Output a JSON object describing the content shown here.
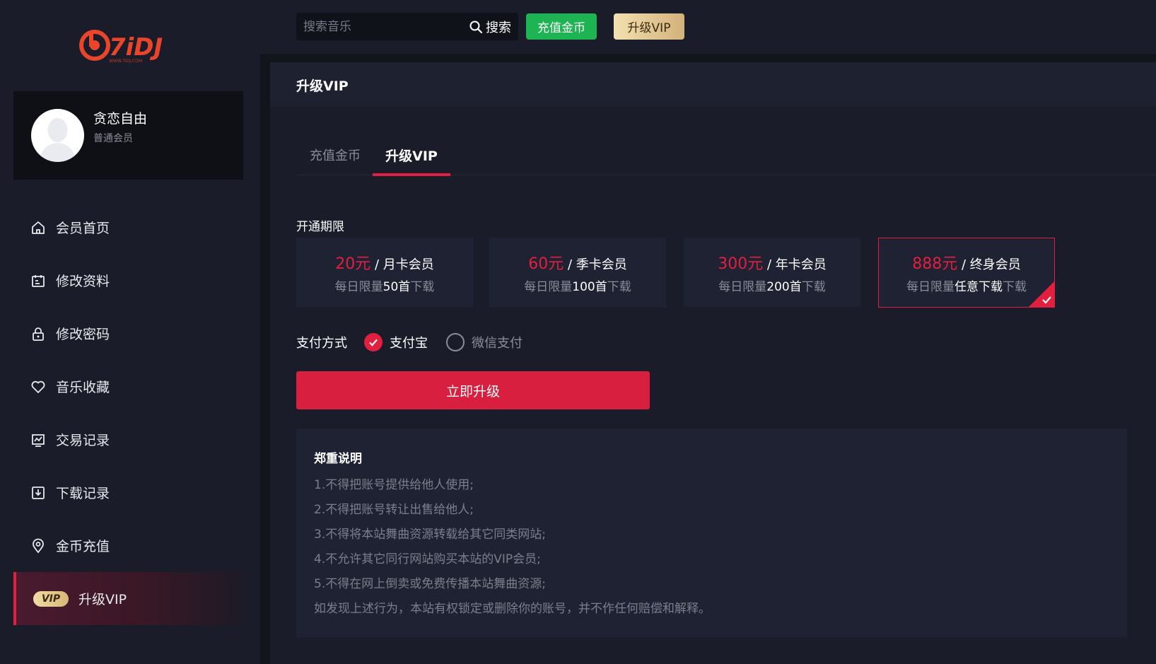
{
  "logo": {
    "text": "7iDJ",
    "sub": "WWW.7IDJ.COM"
  },
  "user": {
    "name": "贪恋自由",
    "level": "普通会员"
  },
  "sidebar": {
    "items": [
      {
        "label": "会员首页",
        "icon": "home-icon"
      },
      {
        "label": "修改资料",
        "icon": "edit-profile-icon"
      },
      {
        "label": "修改密码",
        "icon": "lock-icon"
      },
      {
        "label": "音乐收藏",
        "icon": "heart-icon"
      },
      {
        "label": "交易记录",
        "icon": "chart-icon"
      },
      {
        "label": "下载记录",
        "icon": "download-icon"
      },
      {
        "label": "金币充值",
        "icon": "location-icon"
      },
      {
        "label": "升级VIP",
        "icon": "vip-icon",
        "badge": "VIP",
        "active": true
      }
    ]
  },
  "topbar": {
    "search_placeholder": "搜索音乐",
    "search_label": "搜索",
    "recharge_label": "充值金币",
    "vip_label": "升级VIP"
  },
  "content": {
    "title": "升级VIP",
    "tabs": [
      {
        "label": "充值金币",
        "active": false
      },
      {
        "label": "升级VIP",
        "active": true
      }
    ],
    "period_label": "开通期限",
    "plans": [
      {
        "price": "20元",
        "name": "/ 月卡会员",
        "limit_prefix": "每日限量",
        "limit_value": "50首",
        "limit_suffix": "下载",
        "selected": false
      },
      {
        "price": "60元",
        "name": "/ 季卡会员",
        "limit_prefix": "每日限量",
        "limit_value": "100首",
        "limit_suffix": "下载",
        "selected": false
      },
      {
        "price": "300元",
        "name": "/ 年卡会员",
        "limit_prefix": "每日限量",
        "limit_value": "200首",
        "limit_suffix": "下载",
        "selected": false
      },
      {
        "price": "888元",
        "name": "/ 终身会员",
        "limit_prefix": "每日限量",
        "limit_value": "任意下载",
        "limit_suffix": "下载",
        "selected": true
      }
    ],
    "payment": {
      "label": "支付方式",
      "options": [
        {
          "label": "支付宝",
          "selected": true
        },
        {
          "label": "微信支付",
          "selected": false
        }
      ]
    },
    "submit_label": "立即升级",
    "notice": {
      "title": "郑重说明",
      "lines": [
        "1.不得把账号提供给他人使用;",
        "2.不得把账号转让出售给他人;",
        "3.不得将本站舞曲资源转载给其它同类网站;",
        "4.不允许其它同行网站购买本站的VIP会员;",
        "5.不得在网上倒卖或免费传播本站舞曲资源;",
        "如发现上述行为，本站有权锁定或删除你的账号，并不作任何赔偿和解释。"
      ]
    }
  },
  "colors": {
    "accent": "#e0203e",
    "green": "#1fb453",
    "gold": "#d8b777",
    "bg": "#1a1d29"
  }
}
